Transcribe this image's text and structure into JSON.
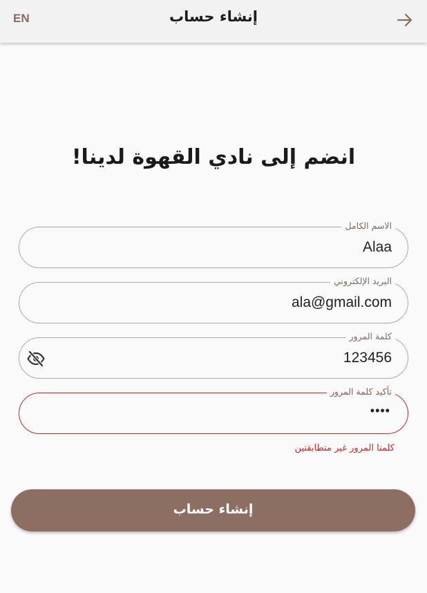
{
  "appbar": {
    "language_toggle": "EN",
    "title": "إنشاء حساب",
    "back_icon": "arrow-forward-icon"
  },
  "headline": "انضم إلى نادي القهوة لدينا!",
  "form": {
    "full_name": {
      "label": "الاسم الكامل",
      "value": "Alaa"
    },
    "email": {
      "label": "البريد الإلكتروني",
      "value": "ala@gmail.com"
    },
    "password": {
      "label": "كلمة المرور",
      "value": "123456",
      "toggle_icon": "eye-off-icon"
    },
    "confirm_password": {
      "label": "تأكيد كلمة المرور",
      "value": "••••"
    },
    "error_message": "كلمتا المرور غير متطابقتين"
  },
  "submit_label": "إنشاء حساب",
  "colors": {
    "accent": "#8d6e63",
    "error": "#c62828",
    "background": "#fafafa",
    "appbar": "#f2f2f2"
  }
}
